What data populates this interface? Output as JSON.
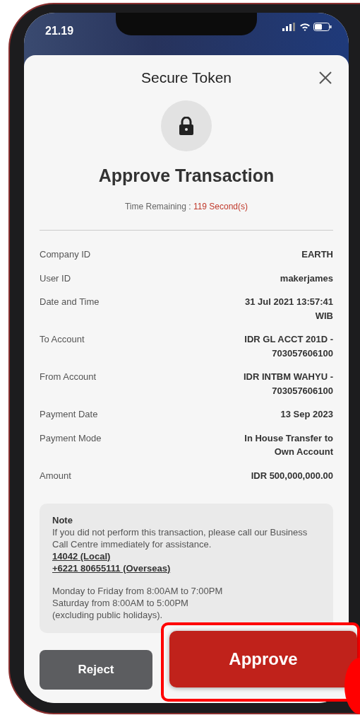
{
  "status_bar": {
    "time": "21.19"
  },
  "sheet": {
    "title": "Secure Token",
    "heading": "Approve Transaction",
    "timer": {
      "label": "Time Remaining :",
      "value": "119 Second(s)"
    }
  },
  "details": [
    {
      "label": "Company ID",
      "value": "EARTH"
    },
    {
      "label": "User ID",
      "value": "makerjames"
    },
    {
      "label": "Date and Time",
      "value": "31 Jul 2021 13:57:41 WIB"
    },
    {
      "label": "To Account",
      "value": "IDR GL ACCT 201D - 703057606100"
    },
    {
      "label": "From Account",
      "value": "IDR INTBM WAHYU - 703057606100"
    },
    {
      "label": "Payment Date",
      "value": "13 Sep 2023"
    },
    {
      "label": "Payment Mode",
      "value": "In House Transfer to Own Account"
    },
    {
      "label": "Amount",
      "value": "IDR 500,000,000.00"
    }
  ],
  "note": {
    "title": "Note",
    "text": "If you did not perform this transaction, please call our Business Call Centre immediately for assistance.",
    "phones": [
      "14042 (Local)",
      "+6221 80655111 (Overseas)"
    ],
    "hours": [
      "Monday to Friday from 8:00AM to 7:00PM",
      "Saturday from 8:00AM to 5:00PM",
      "(excluding public holidays)."
    ]
  },
  "buttons": [
    {
      "label": "Reject",
      "kind": "secondary",
      "highlighted": false
    },
    {
      "label": "Approve",
      "kind": "primary",
      "highlighted": true
    }
  ]
}
